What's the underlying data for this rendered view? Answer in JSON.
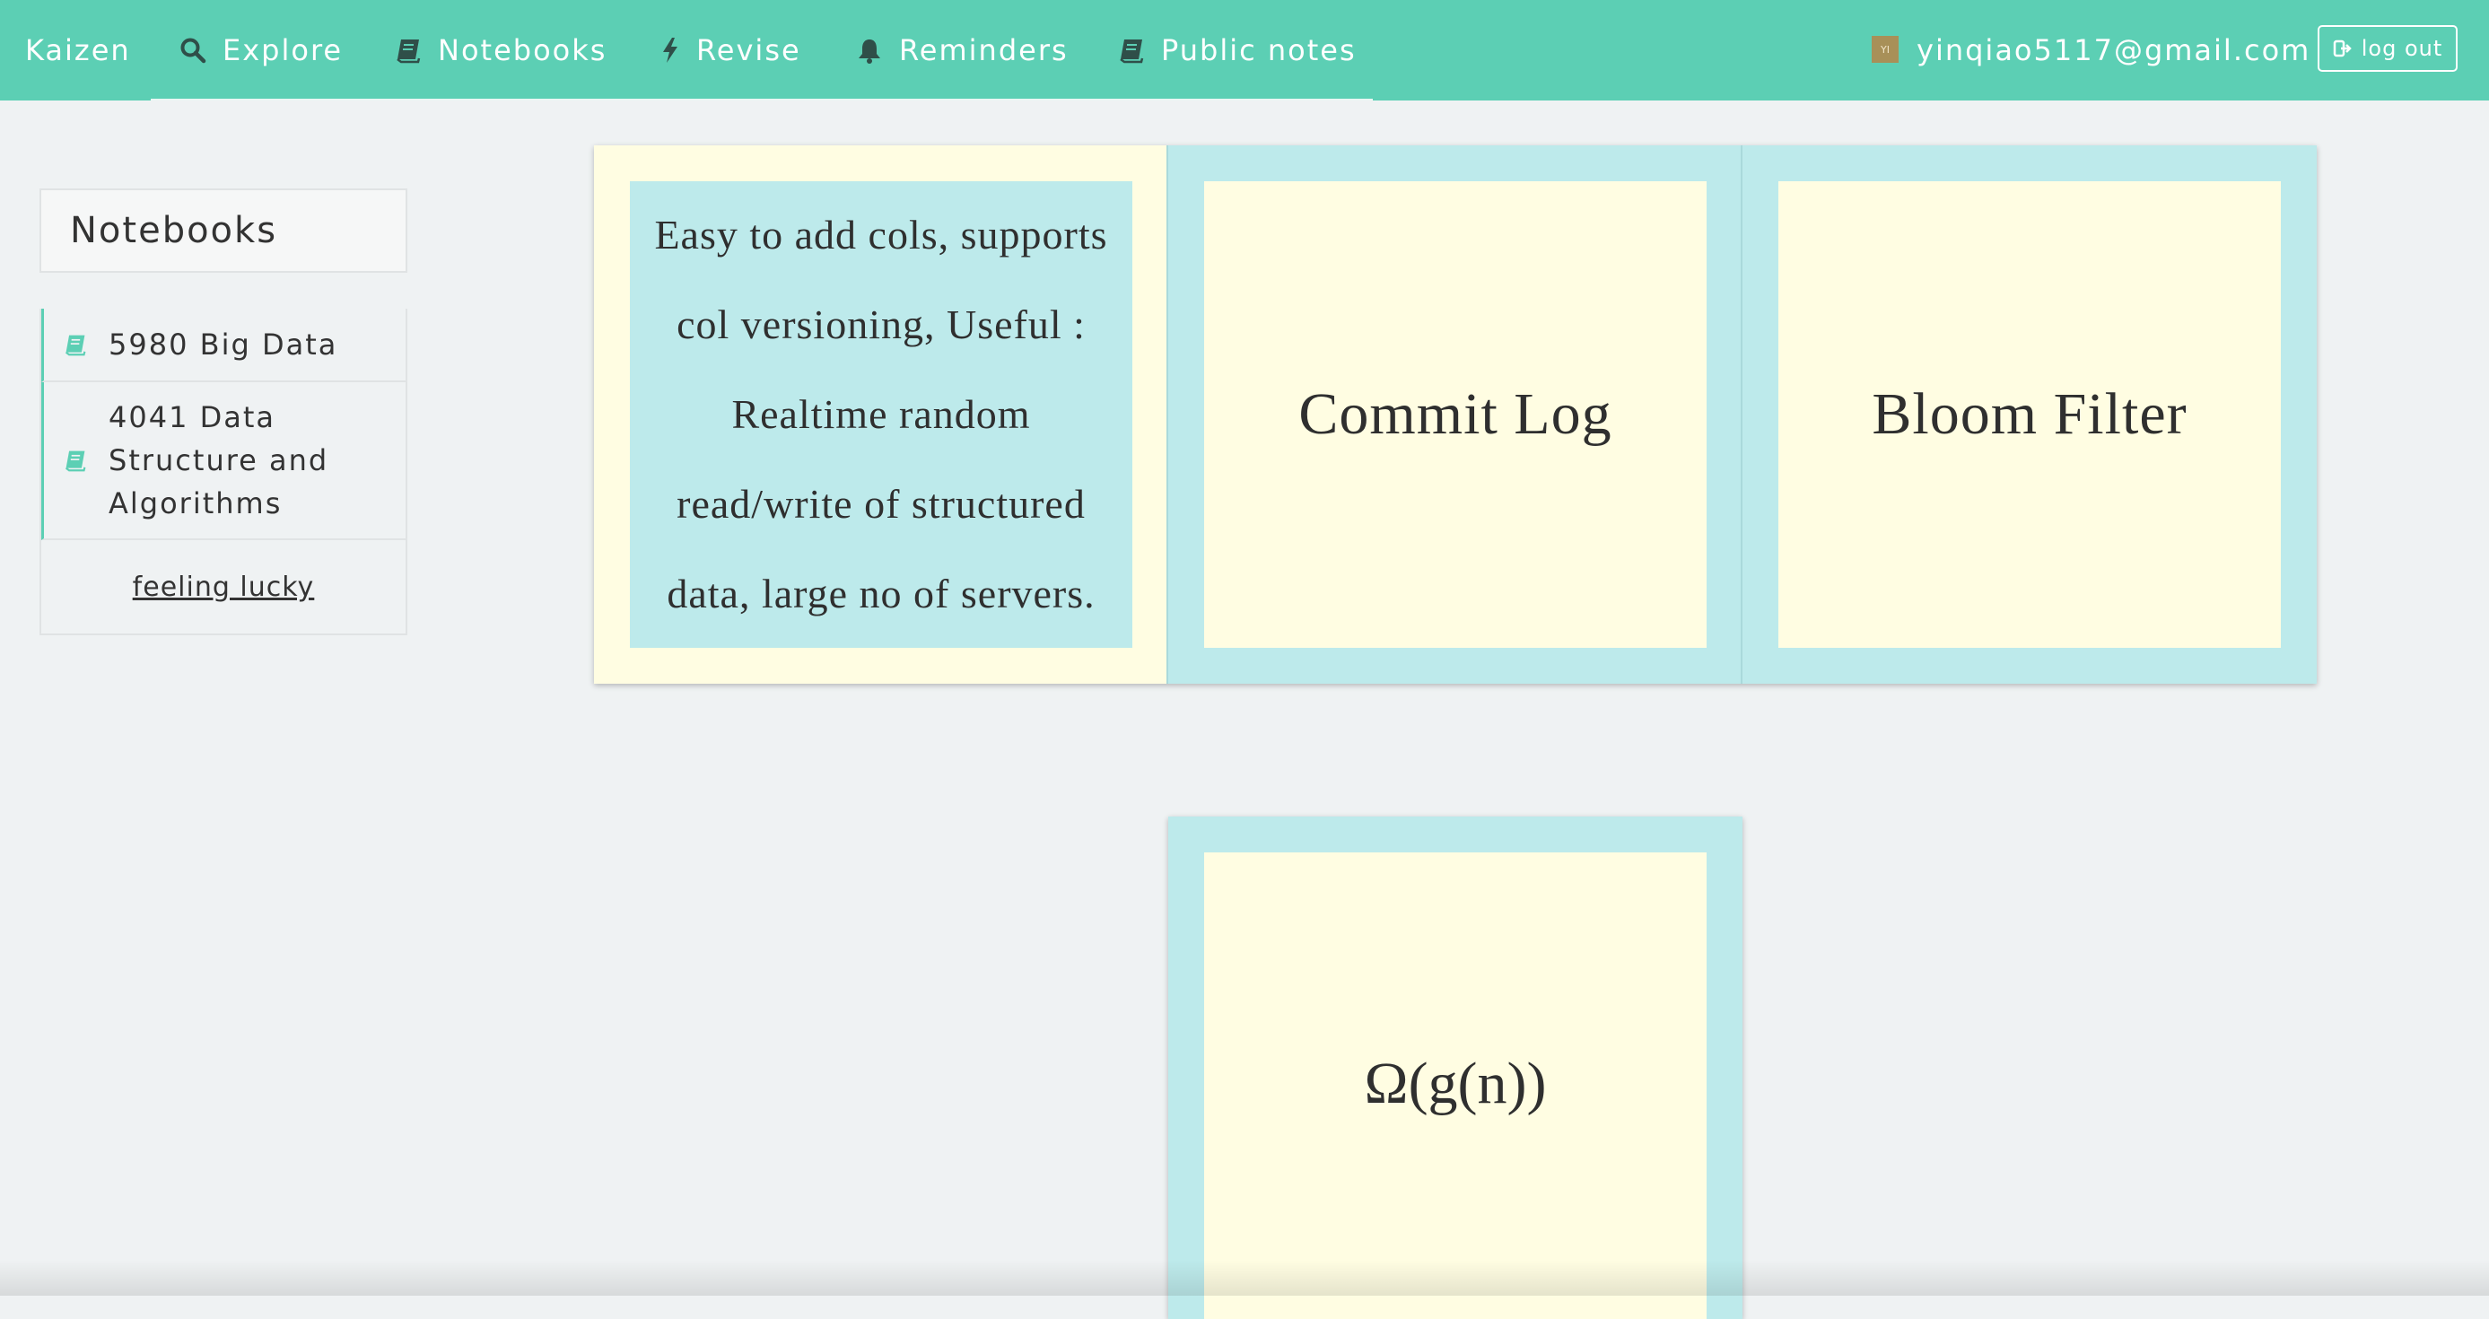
{
  "navbar": {
    "brand": "Kaizen",
    "items": [
      {
        "label": "Explore",
        "icon": "search-icon"
      },
      {
        "label": "Notebooks",
        "icon": "book-icon"
      },
      {
        "label": "Revise",
        "icon": "lightning-icon"
      },
      {
        "label": "Reminders",
        "icon": "bell-icon"
      },
      {
        "label": "Public notes",
        "icon": "book-icon"
      }
    ],
    "user": {
      "avatar_initials": "YI",
      "email": "yinqiao5117@gmail.com"
    },
    "logout_label": "log out"
  },
  "sidebar": {
    "heading": "Notebooks",
    "items": [
      {
        "label": "5980 Big Data",
        "icon": "notebook-icon"
      },
      {
        "label_lines": [
          "4041 Data",
          "Structure and",
          "Algorithms"
        ],
        "icon": "notebook-icon"
      }
    ],
    "lucky_label": "feeling lucky"
  },
  "cards": {
    "row": [
      {
        "text_lines": [
          "Easy to add cols, supports",
          "col versioning, Useful :",
          "Realtime random",
          "read/write of structured",
          "data, large no of servers."
        ]
      },
      {
        "text": "Commit Log"
      },
      {
        "text": "Bloom Filter"
      }
    ],
    "single": {
      "text": "Ω(g(n))"
    }
  },
  "colors": {
    "navbar": "#5ccfb4",
    "background": "#eff2f3",
    "card_blue": "#bdeaeb",
    "card_yellow": "#fffde2"
  }
}
